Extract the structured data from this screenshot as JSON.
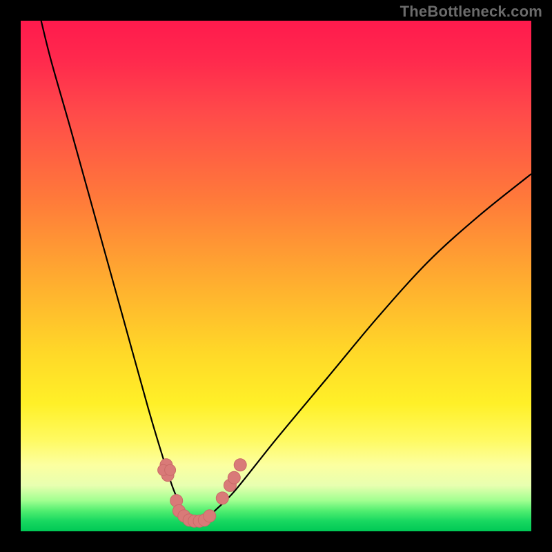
{
  "watermark": "TheBottleneck.com",
  "colors": {
    "gradient_top": "#ff1a4d",
    "gradient_mid": "#ffd828",
    "gradient_bottom": "#00c855",
    "curve": "#000000",
    "bead": "#d97a78",
    "frame": "#000000"
  },
  "chart_data": {
    "type": "line",
    "title": "",
    "xlabel": "",
    "ylabel": "",
    "xlim": [
      0,
      100
    ],
    "ylim": [
      0,
      100
    ],
    "series": [
      {
        "name": "bottleneck-curve",
        "x": [
          4,
          6,
          10,
          15,
          20,
          25,
          28,
          30,
          32,
          34,
          35,
          36,
          38,
          42,
          50,
          60,
          70,
          80,
          90,
          100
        ],
        "y": [
          100,
          92,
          78,
          60,
          42,
          24,
          14,
          8,
          4,
          2,
          2,
          2,
          4,
          8,
          18,
          30,
          42,
          53,
          62,
          70
        ]
      }
    ],
    "markers": {
      "name": "highlight-beads",
      "points": [
        {
          "x": 28.5,
          "y": 13
        },
        {
          "x": 28.8,
          "y": 11
        },
        {
          "x": 30.5,
          "y": 6
        },
        {
          "x": 31.0,
          "y": 4
        },
        {
          "x": 32.0,
          "y": 3
        },
        {
          "x": 33.0,
          "y": 2.2
        },
        {
          "x": 34.0,
          "y": 2
        },
        {
          "x": 35.0,
          "y": 2
        },
        {
          "x": 36.0,
          "y": 2.2
        },
        {
          "x": 37.0,
          "y": 3
        },
        {
          "x": 39.5,
          "y": 6.5
        },
        {
          "x": 41.0,
          "y": 9
        },
        {
          "x": 41.8,
          "y": 10.5
        },
        {
          "x": 43.0,
          "y": 13
        }
      ]
    },
    "grid": false,
    "legend": false
  }
}
